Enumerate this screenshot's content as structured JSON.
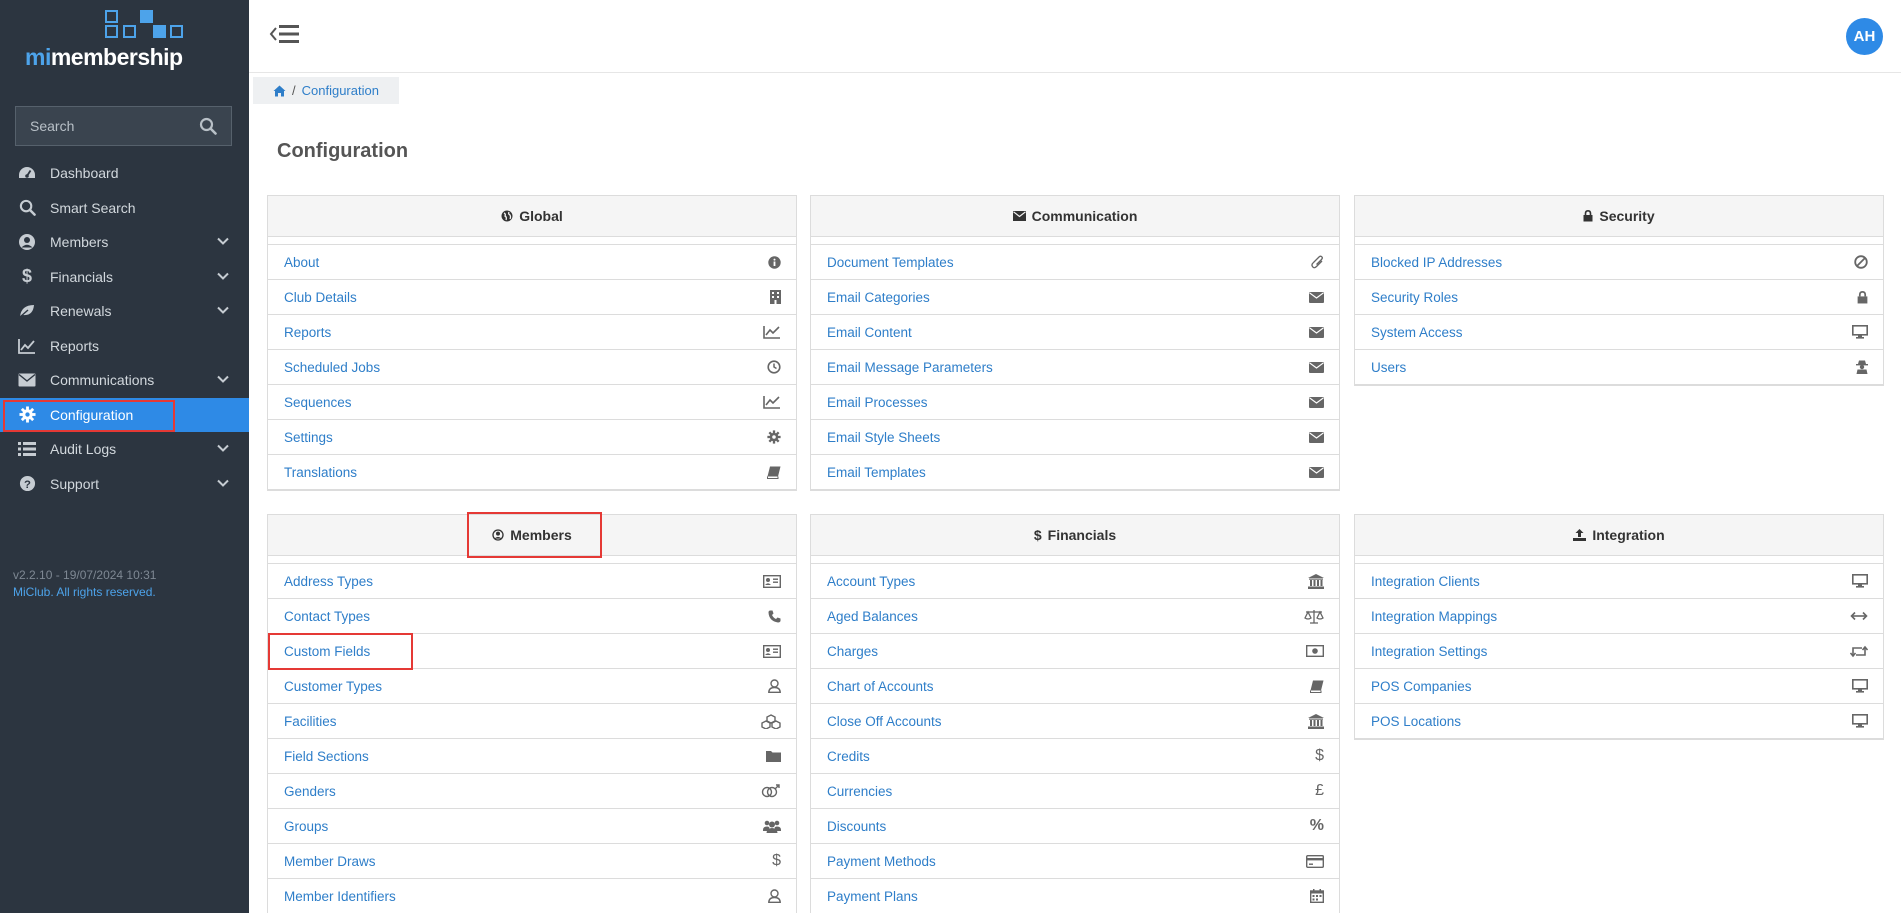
{
  "app": {
    "logo_prefix": "mi",
    "logo_suffix": "membership",
    "search_placeholder": "Search",
    "version": "v2.2.10 - 19/07/2024 10:31",
    "copyright": "MiClub. All rights reserved.",
    "avatar_initials": "AH"
  },
  "nav": [
    {
      "label": "Dashboard",
      "icon": "dashboard-icon",
      "chevron": false
    },
    {
      "label": "Smart Search",
      "icon": "search-icon",
      "chevron": false
    },
    {
      "label": "Members",
      "icon": "user-circle-icon",
      "chevron": true
    },
    {
      "label": "Financials",
      "icon": "dollar-icon",
      "chevron": true
    },
    {
      "label": "Renewals",
      "icon": "leaf-icon",
      "chevron": true
    },
    {
      "label": "Reports",
      "icon": "line-chart-icon",
      "chevron": false
    },
    {
      "label": "Communications",
      "icon": "envelope-icon",
      "chevron": true
    },
    {
      "label": "Configuration",
      "icon": "gear-icon",
      "chevron": false,
      "active": true
    },
    {
      "label": "Audit Logs",
      "icon": "list-icon",
      "chevron": true
    },
    {
      "label": "Support",
      "icon": "question-icon",
      "chevron": true
    }
  ],
  "breadcrumb": {
    "home_icon": "home-icon",
    "current": "Configuration"
  },
  "page_title": "Configuration",
  "panels": {
    "global": {
      "title": "Global",
      "icon": "globe-icon",
      "items": [
        {
          "label": "About",
          "icon": "info-icon"
        },
        {
          "label": "Club Details",
          "icon": "building-icon"
        },
        {
          "label": "Reports",
          "icon": "line-chart-icon"
        },
        {
          "label": "Scheduled Jobs",
          "icon": "clock-icon"
        },
        {
          "label": "Sequences",
          "icon": "line-chart-icon"
        },
        {
          "label": "Settings",
          "icon": "gear-icon"
        },
        {
          "label": "Translations",
          "icon": "book-icon"
        }
      ]
    },
    "communication": {
      "title": "Communication",
      "icon": "envelope-icon",
      "items": [
        {
          "label": "Document Templates",
          "icon": "paperclip-icon"
        },
        {
          "label": "Email Categories",
          "icon": "envelope-icon"
        },
        {
          "label": "Email Content",
          "icon": "envelope-icon"
        },
        {
          "label": "Email Message Parameters",
          "icon": "envelope-icon"
        },
        {
          "label": "Email Processes",
          "icon": "envelope-icon"
        },
        {
          "label": "Email Style Sheets",
          "icon": "envelope-icon"
        },
        {
          "label": "Email Templates",
          "icon": "envelope-icon"
        }
      ]
    },
    "security": {
      "title": "Security",
      "icon": "lock-icon",
      "items": [
        {
          "label": "Blocked IP Addresses",
          "icon": "ban-icon"
        },
        {
          "label": "Security Roles",
          "icon": "lock-icon"
        },
        {
          "label": "System Access",
          "icon": "desktop-icon"
        },
        {
          "label": "Users",
          "icon": "user-secret-icon"
        }
      ]
    },
    "members": {
      "title": "Members",
      "icon": "user-circle-icon",
      "items": [
        {
          "label": "Address Types",
          "icon": "id-card-icon"
        },
        {
          "label": "Contact Types",
          "icon": "phone-icon"
        },
        {
          "label": "Custom Fields",
          "icon": "id-card-icon"
        },
        {
          "label": "Customer Types",
          "icon": "user-icon"
        },
        {
          "label": "Facilities",
          "icon": "cubes-icon"
        },
        {
          "label": "Field Sections",
          "icon": "folder-icon"
        },
        {
          "label": "Genders",
          "icon": "genderless-icon"
        },
        {
          "label": "Groups",
          "icon": "users-icon"
        },
        {
          "label": "Member Draws",
          "icon": "dollar-icon"
        },
        {
          "label": "Member Identifiers",
          "icon": "user-icon"
        }
      ]
    },
    "financials": {
      "title": "Financials",
      "icon": "dollar-icon",
      "items": [
        {
          "label": "Account Types",
          "icon": "bank-icon"
        },
        {
          "label": "Aged Balances",
          "icon": "balance-scale-icon"
        },
        {
          "label": "Charges",
          "icon": "money-icon"
        },
        {
          "label": "Chart of Accounts",
          "icon": "book-icon"
        },
        {
          "label": "Close Off Accounts",
          "icon": "bank-icon"
        },
        {
          "label": "Credits",
          "icon": "dollar-icon"
        },
        {
          "label": "Currencies",
          "icon": "pound-icon"
        },
        {
          "label": "Discounts",
          "icon": "percent-icon"
        },
        {
          "label": "Payment Methods",
          "icon": "credit-card-icon"
        },
        {
          "label": "Payment Plans",
          "icon": "calendar-icon"
        }
      ]
    },
    "integration": {
      "title": "Integration",
      "icon": "upload-icon",
      "items": [
        {
          "label": "Integration Clients",
          "icon": "desktop-icon"
        },
        {
          "label": "Integration Mappings",
          "icon": "arrows-h-icon"
        },
        {
          "label": "Integration Settings",
          "icon": "retweet-icon"
        },
        {
          "label": "POS Companies",
          "icon": "desktop-icon"
        },
        {
          "label": "POS Locations",
          "icon": "desktop-icon"
        }
      ]
    }
  },
  "colors": {
    "sidebar": "#2c3540",
    "accent": "#2e8ae6",
    "link": "#2e7ec9",
    "highlight": "#e53935"
  }
}
